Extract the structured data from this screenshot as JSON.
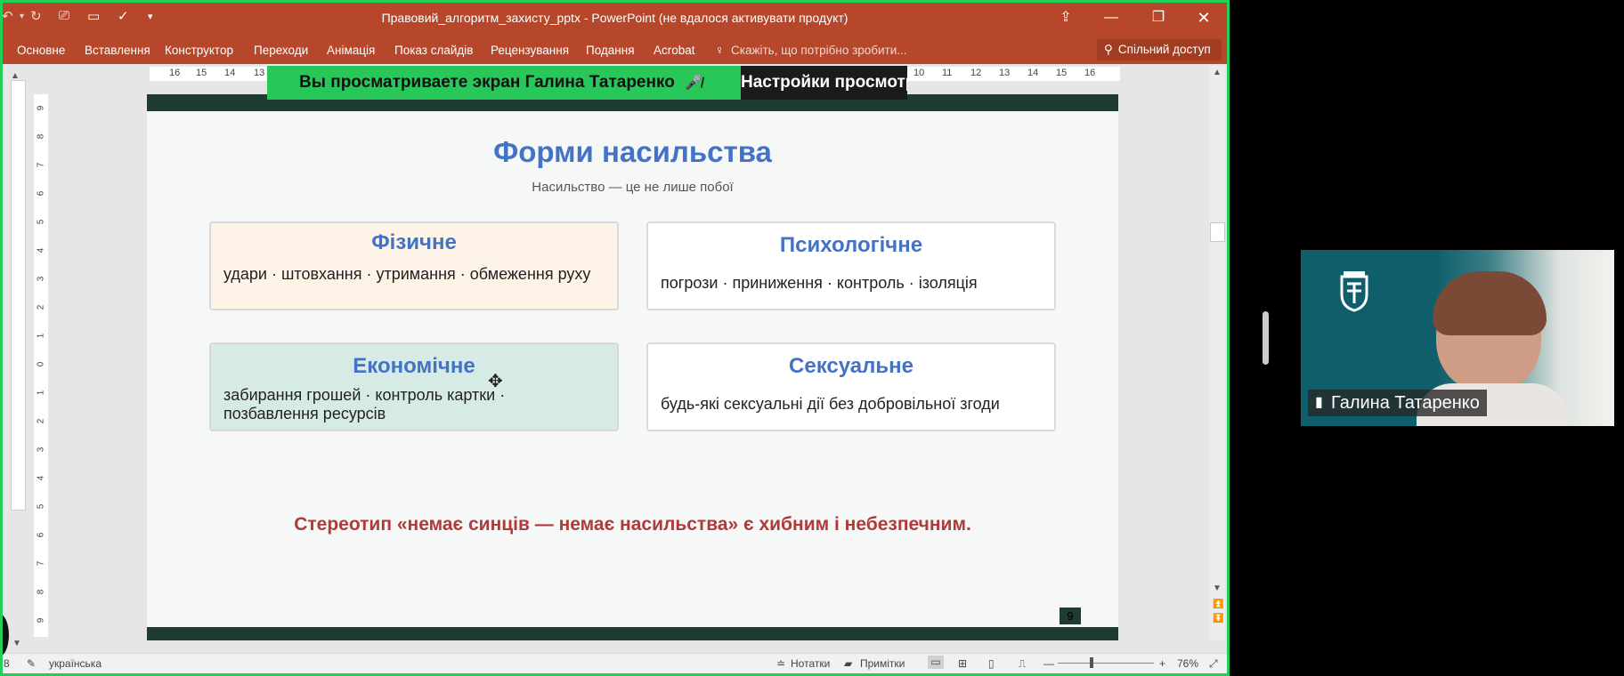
{
  "window": {
    "title": "Правовий_алгоритм_захисту_pptx - PowerPoint (не вдалося активувати продукт)"
  },
  "ribbon": {
    "tabs": [
      "Основне",
      "Вставлення",
      "Конструктор",
      "Переходи",
      "Анімація",
      "Показ слайдів",
      "Рецензування",
      "Подання",
      "Acrobat"
    ],
    "tell_me": "Скажіть, що потрібно зробити...",
    "share": "Спільний доступ"
  },
  "ruler": {
    "left_numbers": [
      "16",
      "15",
      "14",
      "13"
    ],
    "right_numbers": [
      "10",
      "11",
      "12",
      "13",
      "14",
      "15",
      "16"
    ],
    "vertical_numbers": [
      "9",
      "8",
      "7",
      "6",
      "5",
      "4",
      "3",
      "2",
      "1",
      "0",
      "1",
      "2",
      "3",
      "4",
      "5",
      "6",
      "7",
      "8",
      "9"
    ]
  },
  "banner": {
    "viewing": "Вы просматриваете экран  Галина Татаренко",
    "settings": "Настройки просмотра"
  },
  "slide": {
    "title": "Форми насильства",
    "subtitle": "Насильство — це не лише побої",
    "cards": [
      {
        "heading": "Фізичне",
        "text": "удари · штовхання · утримання · обмеження руху",
        "bg": "#fdf4e7"
      },
      {
        "heading": "Психологічне",
        "text": "погрози · приниження · контроль · ізоляція",
        "bg": "#ffffff"
      },
      {
        "heading": "Економічне",
        "text": "забирання грошей · контроль картки · позбавлення ресурсів",
        "bg": "#d7ebe6"
      },
      {
        "heading": "Сексуальне",
        "text": "будь-які сексуальні дії без добровільної згоди",
        "bg": "#ffffff"
      }
    ],
    "warning": "Стереотип «немає синців — немає насильства» є хибним і небезпечним.",
    "page_number": "9"
  },
  "status": {
    "slide_indicator": "8",
    "language": "українська",
    "notes": "Нотатки",
    "comments": "Примітки",
    "zoom": "76%"
  },
  "video": {
    "participant_name": "Галина Татаренко"
  },
  "colors": {
    "ribbon": "#b7472a",
    "share_border": "#1fd157",
    "slide_band": "#1e3b34",
    "heading_blue": "#4472c4",
    "warning_red": "#b03a3a"
  }
}
